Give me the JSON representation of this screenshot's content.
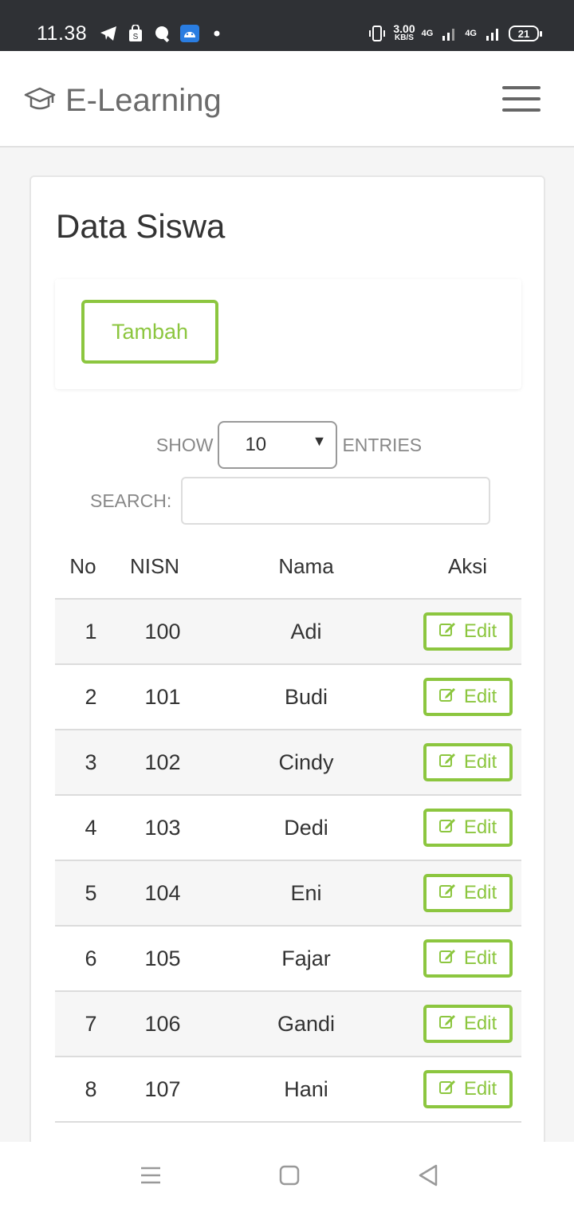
{
  "status_bar": {
    "time": "11.38",
    "speed_value": "3.00",
    "speed_unit": "KB/S",
    "network_1": "4G",
    "network_2": "4G",
    "battery": "21"
  },
  "navbar": {
    "brand": "E-Learning",
    "brand_icon": "graduation-cap-icon",
    "menu_icon": "hamburger-menu-icon"
  },
  "page": {
    "title": "Data Siswa",
    "add_button": "Tambah",
    "length_prefix": "SHOW",
    "length_value": "10",
    "length_suffix": "ENTRIES",
    "search_label": "SEARCH:",
    "search_value": ""
  },
  "table": {
    "headers": {
      "no": "No",
      "nisn": "NISN",
      "nama": "Nama",
      "aksi": "Aksi"
    },
    "rows": [
      {
        "no": "1",
        "nisn": "100",
        "nama": "Adi",
        "action": "Edit"
      },
      {
        "no": "2",
        "nisn": "101",
        "nama": "Budi",
        "action": "Edit"
      },
      {
        "no": "3",
        "nisn": "102",
        "nama": "Cindy",
        "action": "Edit"
      },
      {
        "no": "4",
        "nisn": "103",
        "nama": "Dedi",
        "action": "Edit"
      },
      {
        "no": "5",
        "nisn": "104",
        "nama": "Eni",
        "action": "Edit"
      },
      {
        "no": "6",
        "nisn": "105",
        "nama": "Fajar",
        "action": "Edit"
      },
      {
        "no": "7",
        "nisn": "106",
        "nama": "Gandi",
        "action": "Edit"
      },
      {
        "no": "8",
        "nisn": "107",
        "nama": "Hani",
        "action": "Edit"
      }
    ]
  },
  "colors": {
    "accent": "#8cc63f",
    "status_bar": "#2f3135",
    "text": "#333333",
    "muted": "#888888"
  }
}
